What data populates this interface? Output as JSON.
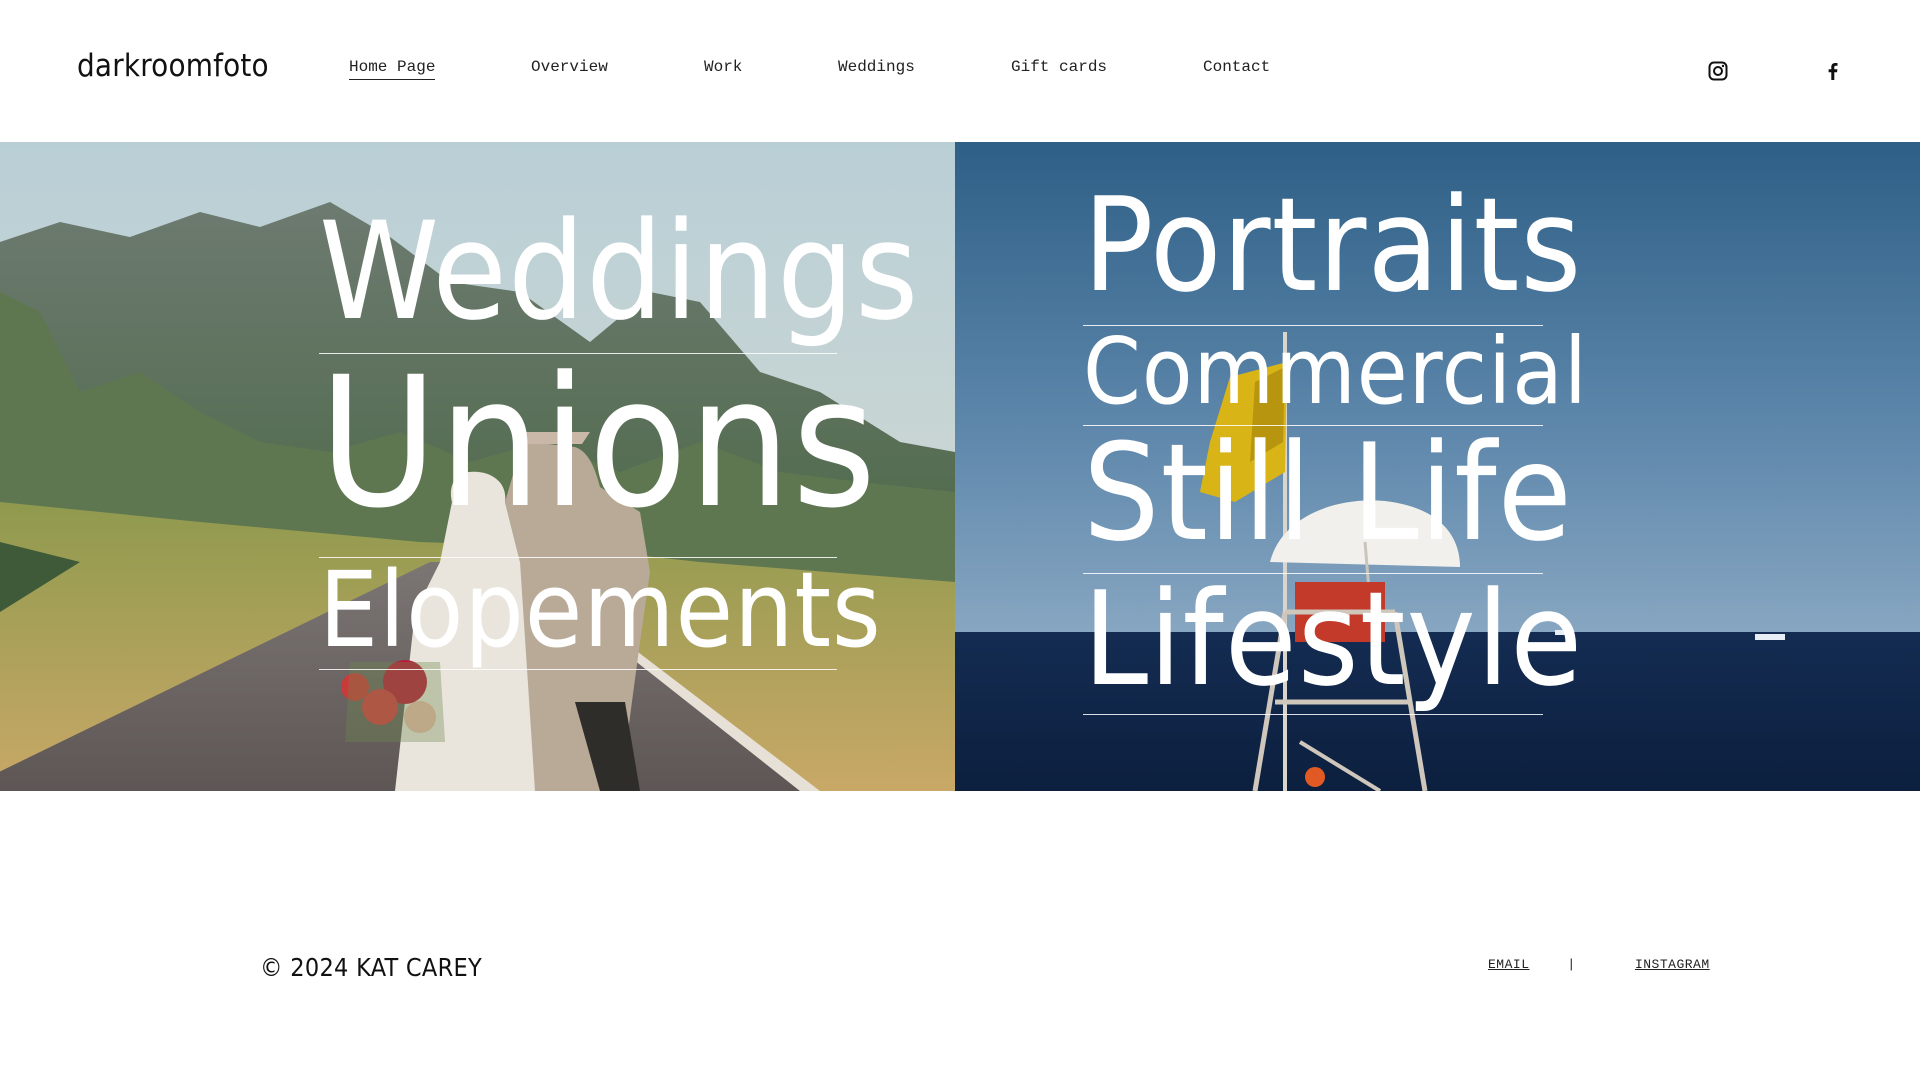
{
  "header": {
    "logo": "darkroomfoto",
    "nav": [
      {
        "label": "Home Page",
        "active": true
      },
      {
        "label": "Overview"
      },
      {
        "label": "Work"
      },
      {
        "label": "Weddings"
      },
      {
        "label": "Gift cards"
      },
      {
        "label": "Contact"
      }
    ],
    "social": [
      "instagram-icon",
      "facebook-icon"
    ]
  },
  "hero": {
    "left_links": [
      "Weddings",
      "Unions",
      "Elopements"
    ],
    "right_links": [
      "Portraits",
      "Commercial",
      "Still Life",
      "Lifestyle"
    ]
  },
  "footer": {
    "copyright": "© 2024 KAT CAREY",
    "email_label": "EMAIL",
    "separator": "|",
    "instagram_label": "INSTAGRAM"
  },
  "colors": {
    "background": "#ffffff",
    "text": "#111111",
    "overlay_text": "#ffffff"
  }
}
